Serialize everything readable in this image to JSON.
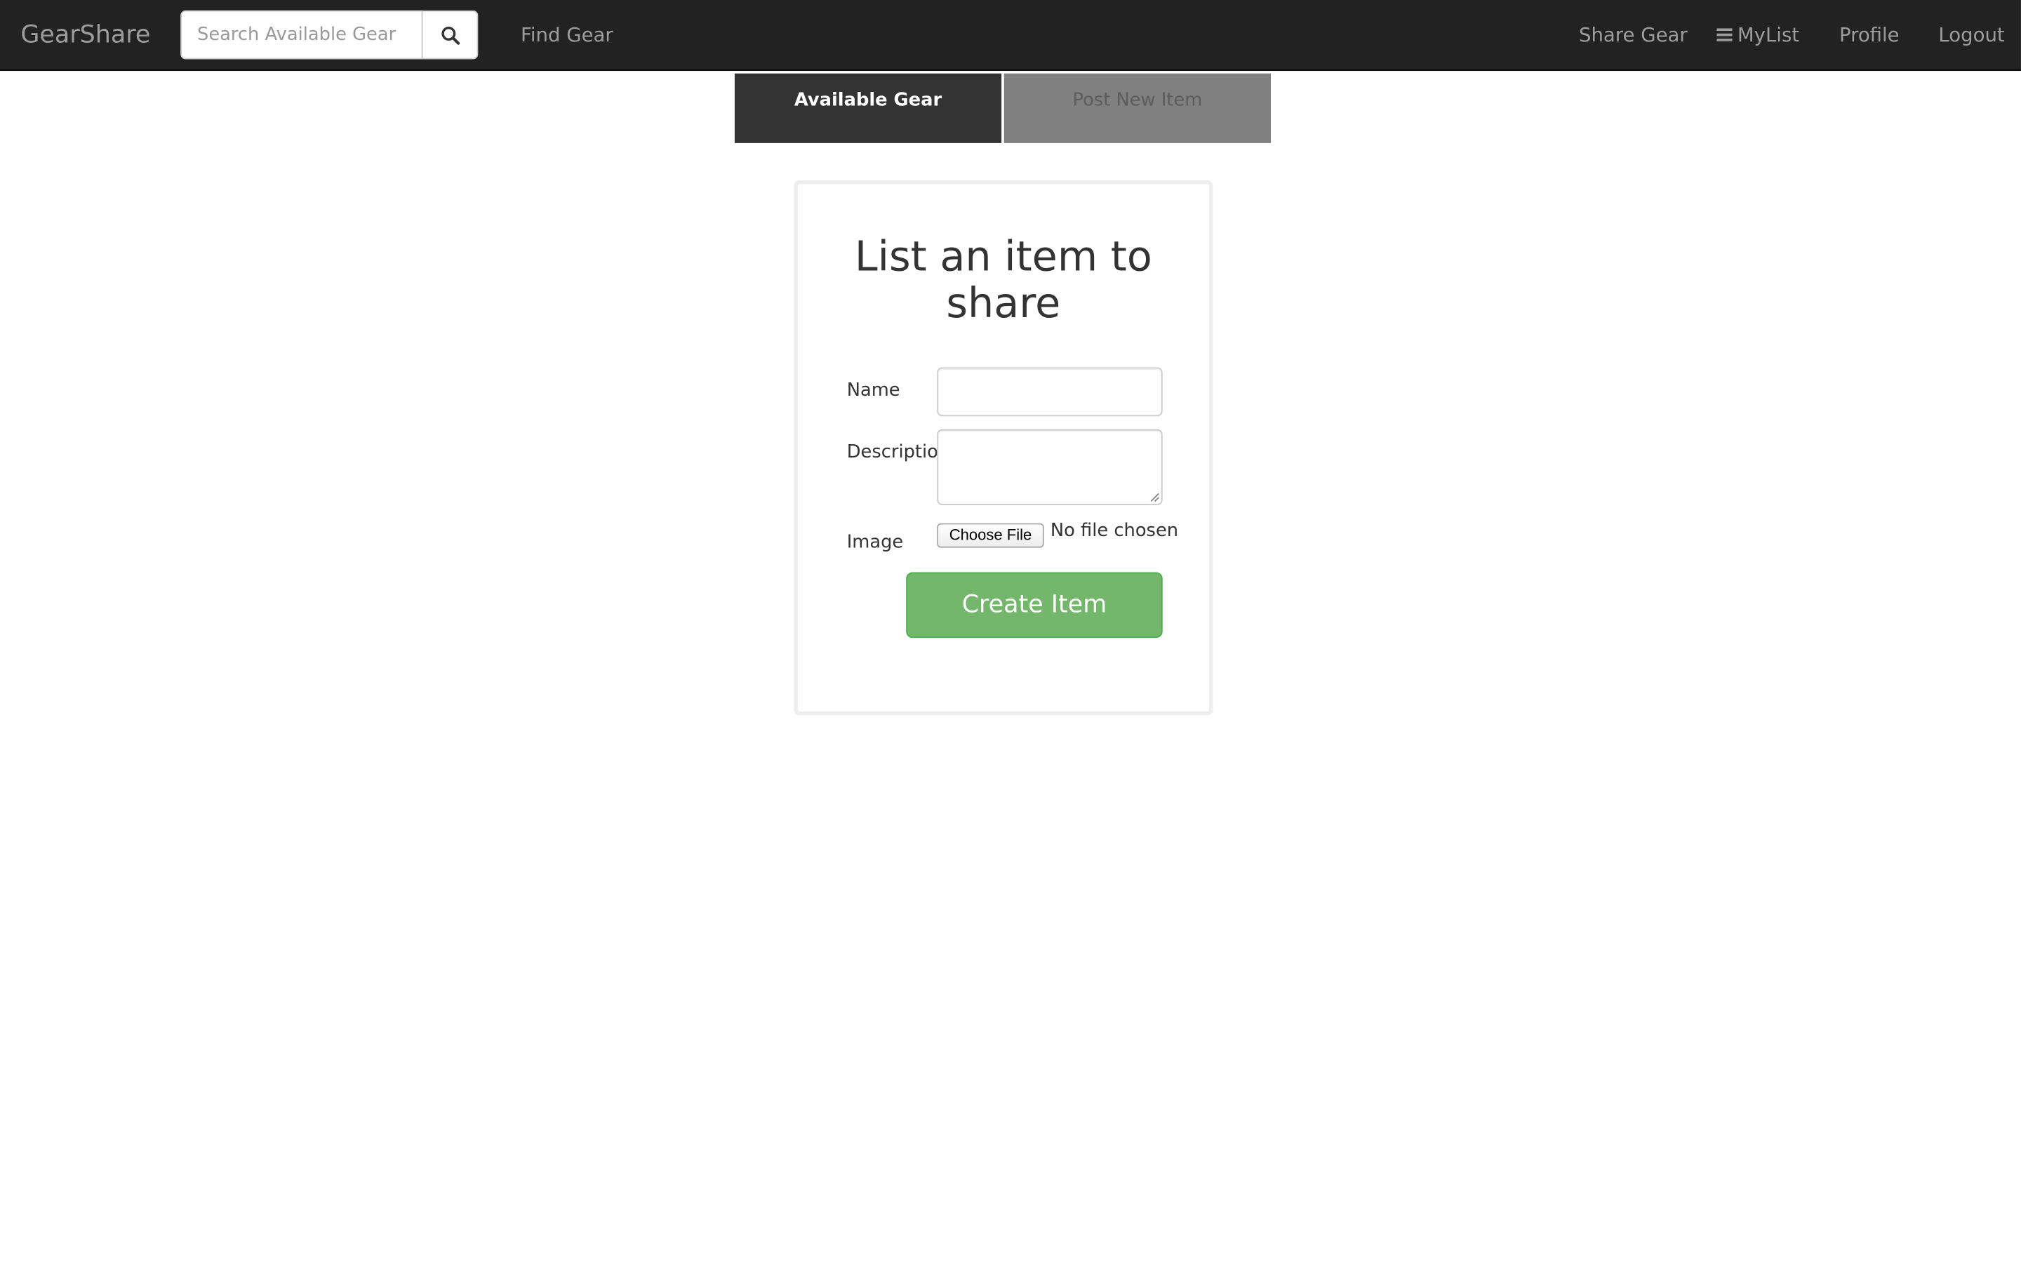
{
  "navbar": {
    "brand": "GearShare",
    "search": {
      "placeholder": "Search Available Gear",
      "value": "",
      "button_icon": "search-icon"
    },
    "links": {
      "find_gear": "Find Gear",
      "share_gear": "Share Gear",
      "mylist": "MyList",
      "mylist_icon": "hamburger-icon",
      "profile": "Profile",
      "logout": "Logout"
    }
  },
  "tabs": [
    {
      "label": "Available Gear",
      "active": true
    },
    {
      "label": "Post New Item",
      "active": false
    }
  ],
  "form": {
    "title": "List an item to share",
    "fields": {
      "name_label": "Name",
      "name_value": "",
      "description_label": "Description",
      "description_value": "",
      "image_label": "Image",
      "file_button": "Choose File",
      "file_status": "No file chosen"
    },
    "submit_label": "Create Item"
  },
  "colors": {
    "navbar_bg": "#222222",
    "nav_text": "#9d9d9d",
    "tab_active_bg": "#333333",
    "tab_inactive_bg": "#808080",
    "success": "#74b66c"
  }
}
